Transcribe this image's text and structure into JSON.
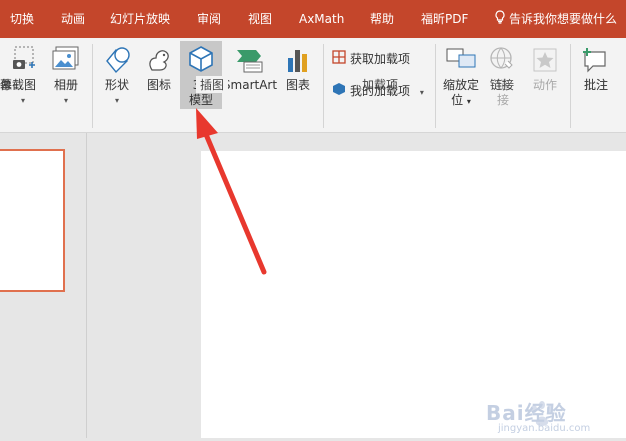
{
  "tabs": [
    {
      "label": "切换"
    },
    {
      "label": "动画"
    },
    {
      "label": "幻灯片放映"
    },
    {
      "label": "审阅"
    },
    {
      "label": "视图"
    },
    {
      "label": "AxMath"
    },
    {
      "label": "帮助"
    },
    {
      "label": "福昕PDF"
    }
  ],
  "tell_me": {
    "label": "告诉我你想要做什么"
  },
  "ribbon": {
    "screenshot_label": "屏幕截图",
    "album_label": "相册",
    "images_group_label": "像",
    "shapes_label": "形状",
    "icons_label": "图标",
    "model3d_line1": "3D",
    "model3d_line2": "模型",
    "smartart_label": "SmartArt",
    "chart_label": "图表",
    "illustrations_group_label": "插图",
    "get_addins_label": "获取加载项",
    "my_addins_label": "我的加载项",
    "addins_group_label": "加载项",
    "zoom_line1": "缩放定",
    "zoom_line2": "位",
    "link_line1": "链",
    "link_line2": "接",
    "action_label": "动作",
    "links_group_label": "链接",
    "comment_label": "批注",
    "comments_group_label": "批注"
  },
  "watermark": {
    "brand": "Bai经验",
    "url": "jingyan.baidu.com"
  },
  "colors": {
    "accent": "#c4462b",
    "thumb_border": "#e0704e",
    "arrow": "#e8382e"
  }
}
